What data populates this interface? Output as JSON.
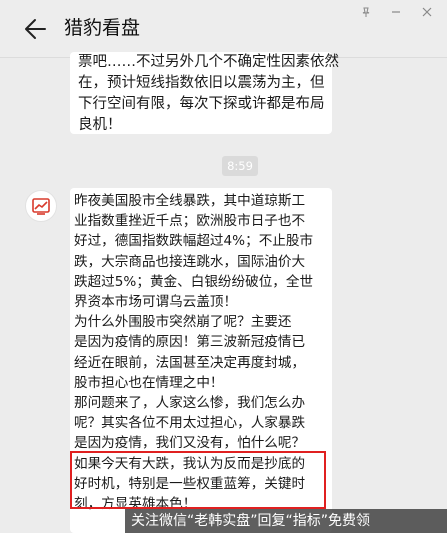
{
  "header": {
    "title": "猎豹看盘"
  },
  "colors": {
    "background": "#ececec",
    "bubble": "#ffffff",
    "highlight": "#e02020",
    "timestamp_bg": "#dadada"
  },
  "icons": {
    "back": "back-arrow-icon",
    "avatar": "chart-app-icon"
  },
  "messages": [
    {
      "lines": [
        "票吧……不过另外几个不确定性因素依然",
        "在，预计短线指数依旧以震荡为主，但",
        "下行空间有限，每次下探或许都是布局",
        "良机！"
      ]
    },
    {
      "timestamp": "8:59"
    },
    {
      "lines": [
        "昨夜美国股市全线暴跌，其中道琼斯工",
        "业指数重挫近千点；欧洲股市日子也不",
        "好过，德国指数跌幅超过4%；不止股市",
        "跌，大宗商品也接连跳水，国际油价大",
        "跌超过5%；黄金、白银纷纷破位，全世",
        "界资本市场可谓乌云盖顶！",
        " 为什么外围股市突然崩了呢？主要还",
        "是因为疫情的原因！第三波新冠疫情已",
        "经近在眼前，法国甚至决定再度封城，",
        "股市担心也在情理之中！",
        "那问题来了，人家这么惨，我们怎么办",
        "呢？其实各位不用太过担心，人家暴跌",
        "是因为疫情，我们又没有，怕什么呢？",
        "如果今天有大跌，我认为反而是抄底的",
        "好时机，特别是一些权重蓝筹，关键时",
        "刻，方显英雄本色！"
      ]
    }
  ],
  "watermark": "关注微信“老韩实盘”回复“指标”免费领"
}
